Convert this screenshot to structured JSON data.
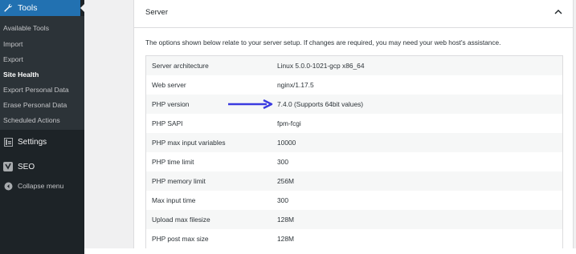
{
  "sidebar": {
    "current_menu": "Tools",
    "submenu": [
      "Available Tools",
      "Import",
      "Export",
      "Site Health",
      "Export Personal Data",
      "Erase Personal Data",
      "Scheduled Actions"
    ],
    "menu_items": [
      "Settings",
      "SEO"
    ],
    "collapse_label": "Collapse menu"
  },
  "panel": {
    "title": "Server",
    "description": "The options shown below relate to your server setup. If changes are required, you may need your web host's assistance.",
    "rows": [
      {
        "key": "Server architecture",
        "value": "Linux 5.0.0-1021-gcp x86_64"
      },
      {
        "key": "Web server",
        "value": "nginx/1.17.5"
      },
      {
        "key": "PHP version",
        "value": "7.4.0 (Supports 64bit values)"
      },
      {
        "key": "PHP SAPI",
        "value": "fpm-fcgi"
      },
      {
        "key": "PHP max input variables",
        "value": "10000"
      },
      {
        "key": "PHP time limit",
        "value": "300"
      },
      {
        "key": "PHP memory limit",
        "value": "256M"
      },
      {
        "key": "Max input time",
        "value": "300"
      },
      {
        "key": "Upload max filesize",
        "value": "128M"
      },
      {
        "key": "PHP post max size",
        "value": "128M"
      }
    ]
  },
  "colors": {
    "accent": "#2271b1",
    "sidebar": "#1d2327",
    "arrow": "#3b3be0"
  }
}
